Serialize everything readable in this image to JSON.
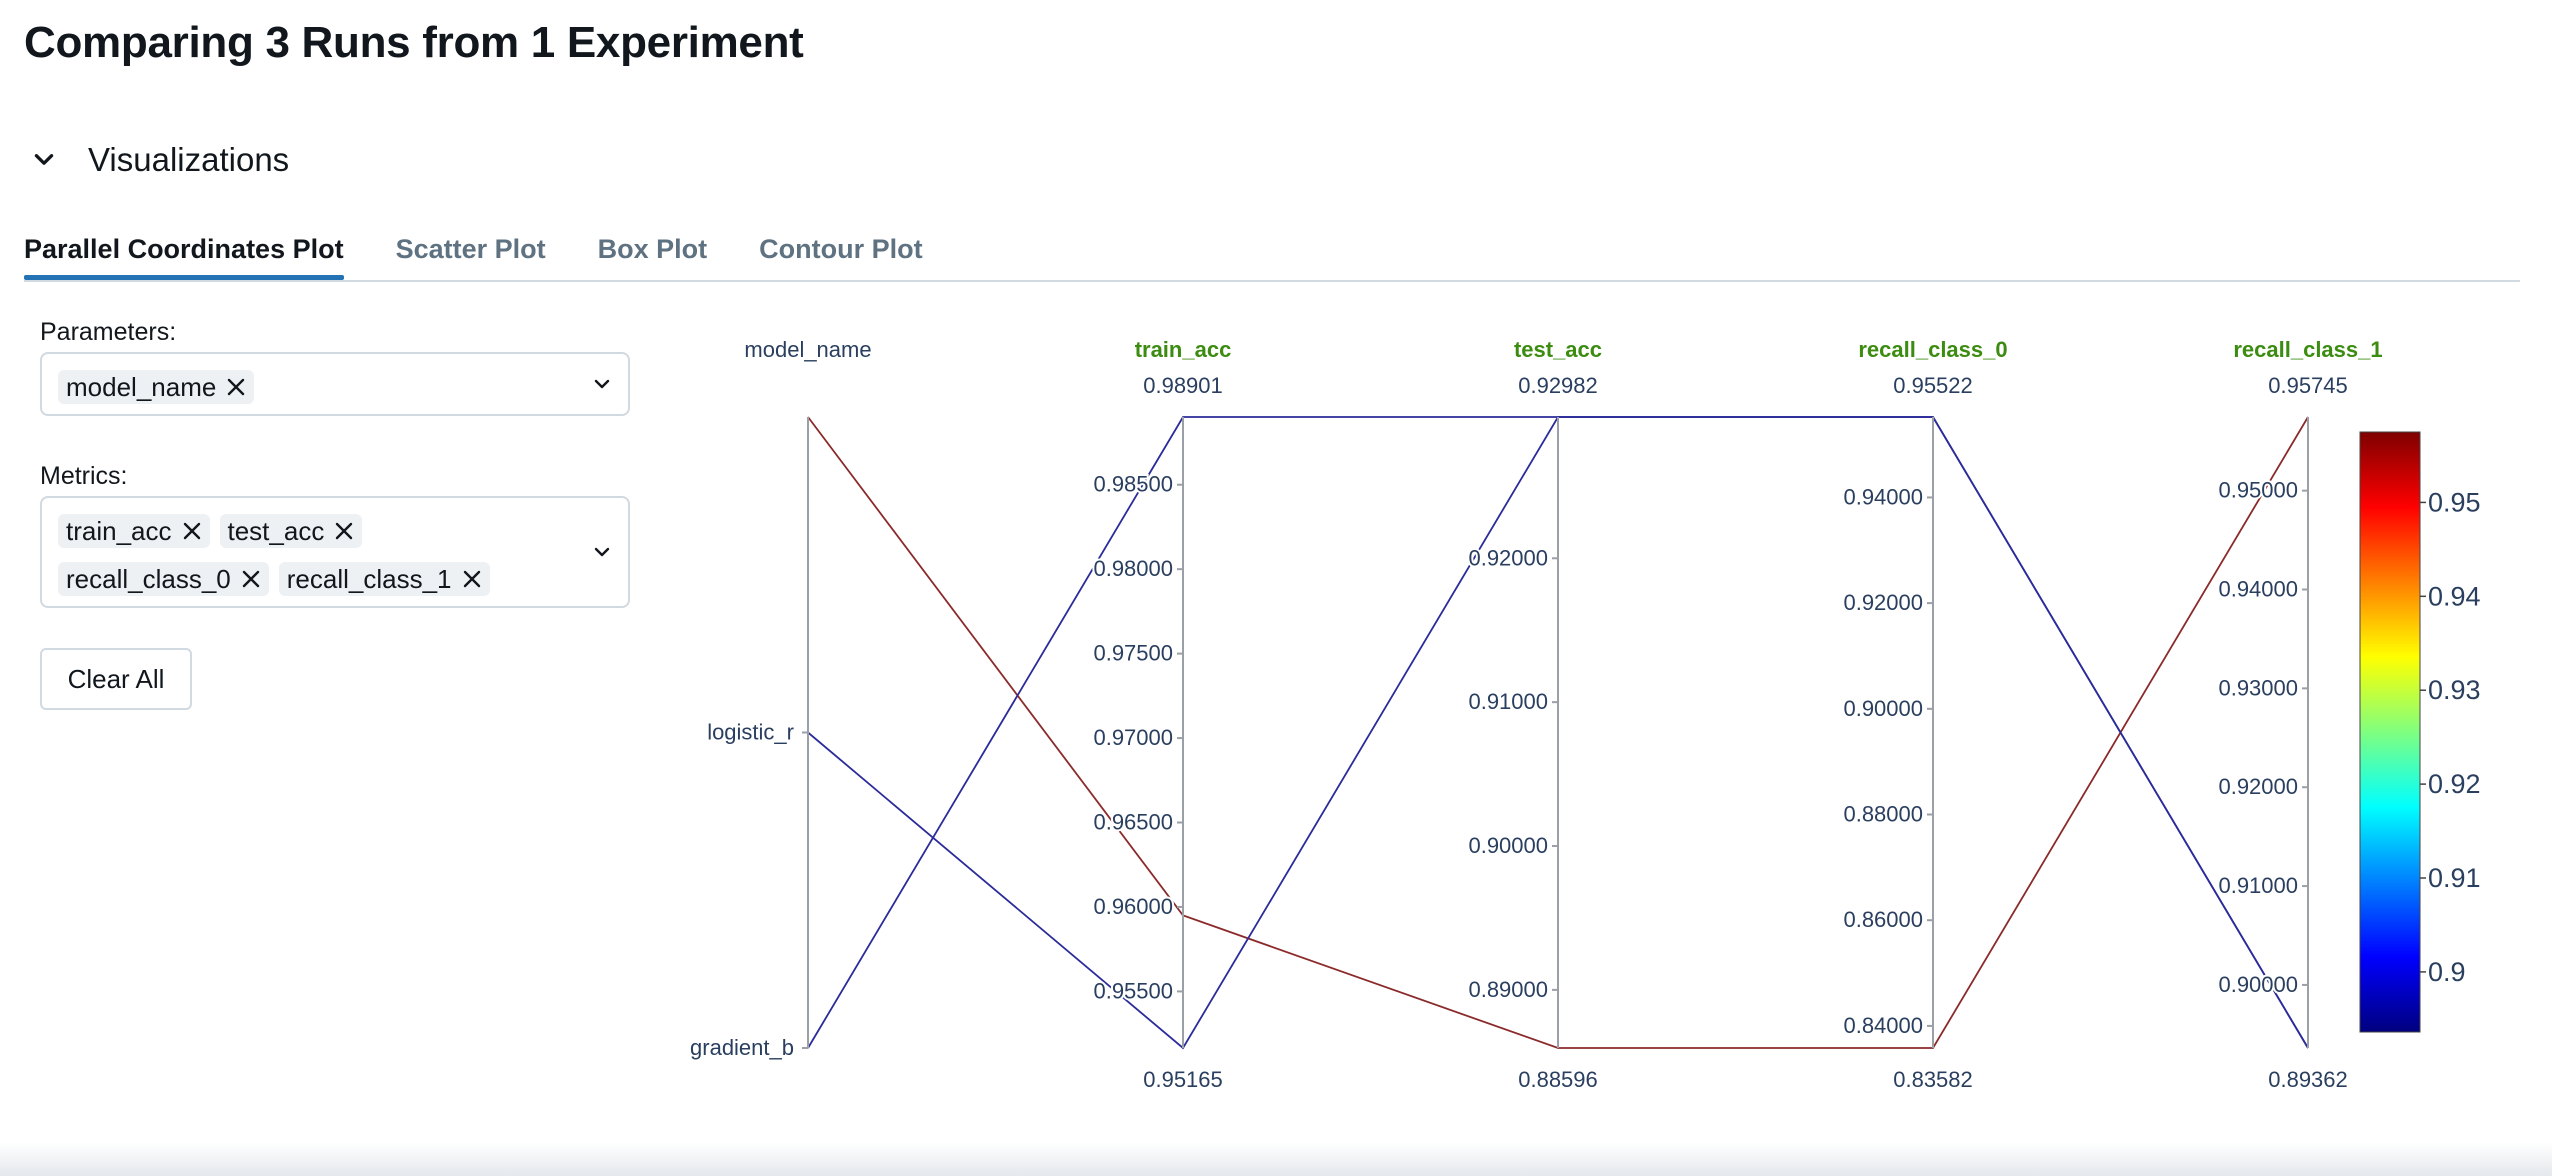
{
  "page": {
    "title": "Comparing 3 Runs from 1 Experiment"
  },
  "section": {
    "label": "Visualizations",
    "icon": "chevron-down-icon"
  },
  "tabs": [
    {
      "label": "Parallel Coordinates Plot",
      "active": true
    },
    {
      "label": "Scatter Plot",
      "active": false
    },
    {
      "label": "Box Plot",
      "active": false
    },
    {
      "label": "Contour Plot",
      "active": false
    }
  ],
  "params": {
    "label": "Parameters:",
    "chips": [
      "model_name"
    ]
  },
  "metrics": {
    "label": "Metrics:",
    "chips": [
      "train_acc",
      "test_acc",
      "recall_class_0",
      "recall_class_1"
    ]
  },
  "clear_all_label": "Clear All",
  "colors": {
    "accent": "#2272b4",
    "metric_axis_title": "#3d8c12",
    "line_high": "#8b2a2a",
    "line_low": "#2b2b9a"
  },
  "chart_data": {
    "type": "parallel_coordinates",
    "color_metric": "recall_class_1",
    "dimensions": [
      {
        "name": "model_name",
        "kind": "categorical",
        "categories": [
          "gradient_b",
          "logistic_r",
          ""
        ],
        "ticks": [
          "logistic_r",
          "gradient_b"
        ]
      },
      {
        "name": "train_acc",
        "kind": "metric",
        "range": [
          0.95165,
          0.98901
        ],
        "range_labels": [
          "0.95165",
          "0.98901"
        ],
        "ticks": [
          "0.95500",
          "0.96000",
          "0.96500",
          "0.97000",
          "0.97500",
          "0.98000",
          "0.98500"
        ]
      },
      {
        "name": "test_acc",
        "kind": "metric",
        "range": [
          0.88596,
          0.92982
        ],
        "range_labels": [
          "0.88596",
          "0.92982"
        ],
        "ticks": [
          "0.89000",
          "0.90000",
          "0.91000",
          "0.92000"
        ]
      },
      {
        "name": "recall_class_0",
        "kind": "metric",
        "range": [
          0.83582,
          0.95522
        ],
        "range_labels": [
          "0.83582",
          "0.95522"
        ],
        "ticks": [
          "0.84000",
          "0.86000",
          "0.88000",
          "0.90000",
          "0.92000",
          "0.94000"
        ]
      },
      {
        "name": "recall_class_1",
        "kind": "metric",
        "range": [
          0.89362,
          0.95745
        ],
        "range_labels": [
          "0.89362",
          "0.95745"
        ],
        "ticks": [
          "0.90000",
          "0.91000",
          "0.92000",
          "0.93000",
          "0.94000",
          "0.95000"
        ]
      }
    ],
    "runs": [
      {
        "values": [
          2,
          0.9595,
          0.88596,
          0.83582,
          0.95745
        ]
      },
      {
        "values": [
          1,
          0.95165,
          0.92982,
          0.95522,
          0.89362
        ]
      },
      {
        "values": [
          0,
          0.98901,
          0.92982,
          0.95522,
          0.89362
        ]
      }
    ],
    "colorbar": {
      "range": [
        0.8936,
        0.9575
      ],
      "ticks": [
        "0.9",
        "0.91",
        "0.92",
        "0.93",
        "0.94",
        "0.95"
      ]
    }
  }
}
